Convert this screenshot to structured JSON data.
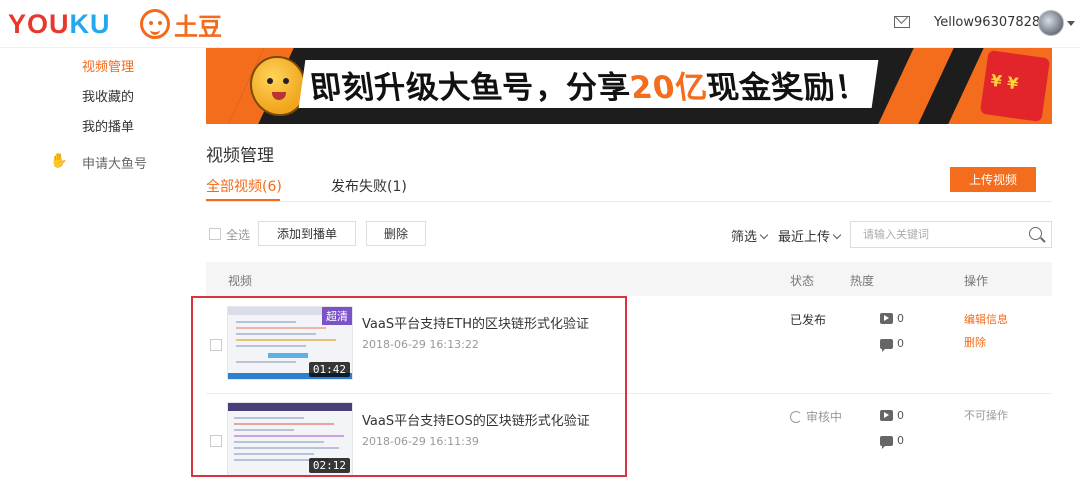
{
  "header": {
    "logo_youku": "YOUKU",
    "logo_tudou": "土豆",
    "mail_icon": "mail-icon",
    "username": "Yellow96307828"
  },
  "sidebar": {
    "items": [
      {
        "label": "视频管理",
        "active": true
      },
      {
        "label": "我收藏的",
        "active": false
      },
      {
        "label": "我的播单",
        "active": false
      }
    ],
    "apply": {
      "icon": "hand-icon",
      "label": "申请大鱼号"
    }
  },
  "banner": {
    "text_before": "即刻升级大鱼号，分享",
    "text_highlight": "20亿",
    "text_after": "现金奖励！"
  },
  "page": {
    "title": "视频管理",
    "tabs": [
      {
        "label": "全部视频(6)",
        "active": true
      },
      {
        "label": "发布失败(1)",
        "active": false
      }
    ],
    "upload_button": "上传视频"
  },
  "toolbar": {
    "select_all": "全选",
    "add_to_playlist": "添加到播单",
    "delete": "删除",
    "filter": "筛选",
    "sort": "最近上传",
    "search_placeholder": "请输入关键词"
  },
  "table": {
    "columns": [
      "视频",
      "状态",
      "热度",
      "操作"
    ],
    "rows": [
      {
        "title": "VaaS平台支持ETH的区块链形式化验证",
        "date": "2018-06-29 16:13:22",
        "duration": "01:42",
        "badge": "超清",
        "status": "已发布",
        "plays": "0",
        "comments": "0",
        "actions": [
          "编辑信息",
          "删除"
        ]
      },
      {
        "title": "VaaS平台支持EOS的区块链形式化验证",
        "date": "2018-06-29 16:11:39",
        "duration": "02:12",
        "status": "审核中",
        "plays": "0",
        "comments": "0",
        "actions_disabled": "不可操作"
      }
    ]
  },
  "colors": {
    "accent": "#f26a1b",
    "highlight_box": "#d9333f"
  }
}
